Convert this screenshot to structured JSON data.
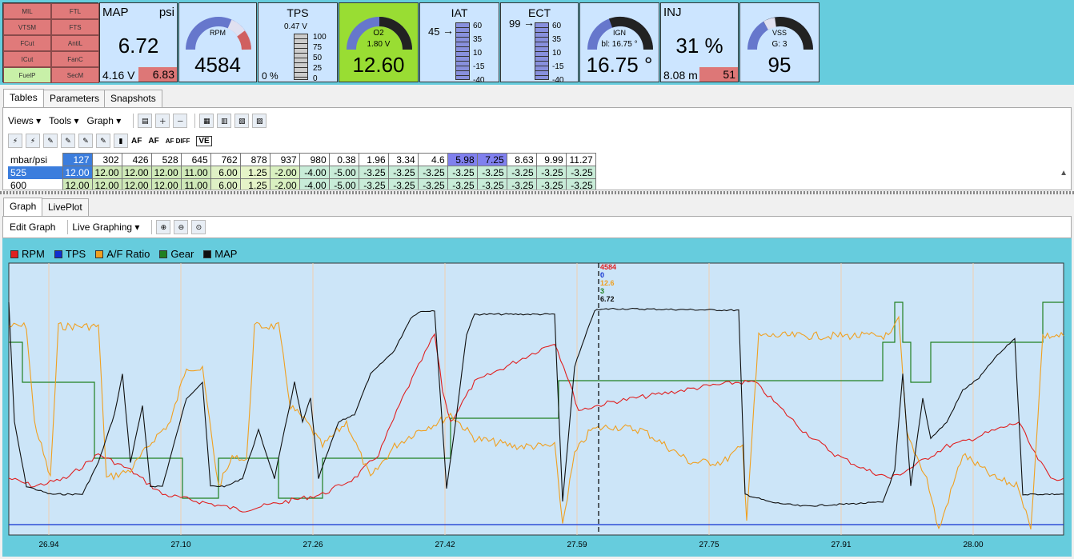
{
  "flags": [
    {
      "label": "MIL",
      "on": false
    },
    {
      "label": "FTL",
      "on": false
    },
    {
      "label": "VTSM",
      "on": false
    },
    {
      "label": "FTS",
      "on": false
    },
    {
      "label": "FCut",
      "on": false
    },
    {
      "label": "AntiL",
      "on": false
    },
    {
      "label": "ICut",
      "on": false
    },
    {
      "label": "FanC",
      "on": false
    },
    {
      "label": "FuelP",
      "on": true
    },
    {
      "label": "SecM",
      "on": false
    }
  ],
  "map": {
    "title": "MAP",
    "unit": "psi",
    "value": "6.72",
    "volts": "4.16 V",
    "alt": "6.83"
  },
  "rpm": {
    "label": "RPM",
    "value": "4584",
    "fraction": 0.55
  },
  "tps": {
    "title": "TPS",
    "volts": "0.47 V",
    "pct": "0 %",
    "scale": [
      "100",
      "75",
      "50",
      "25",
      "0"
    ]
  },
  "o2": {
    "label": "O2",
    "volts": "1.80 V",
    "value": "12.60",
    "fraction": 0.85
  },
  "iat": {
    "title": "IAT",
    "value": "45",
    "scale": [
      "60",
      "35",
      "10",
      "-15",
      "-40"
    ]
  },
  "ect": {
    "title": "ECT",
    "value": "99",
    "scale": [
      "60",
      "35",
      "10",
      "-15",
      "-40"
    ]
  },
  "ign": {
    "label": "IGN",
    "sub": "bl: 16.75 °",
    "value": "16.75 °",
    "fraction": 0.6
  },
  "inj": {
    "title": "INJ",
    "value": "31 %",
    "left": "8.08 m",
    "right": "51"
  },
  "vss": {
    "label": "VSS",
    "sub": "G: 3",
    "value": "95",
    "fraction": 0.35
  },
  "top_tabs": [
    "Tables",
    "Parameters",
    "Snapshots"
  ],
  "toolbar": {
    "views": "Views",
    "tools": "Tools",
    "graph": "Graph",
    "af1": "AF",
    "af2": "AF",
    "afdiff": "AF DIFF",
    "ve": "VE"
  },
  "fuel_table": {
    "corner": "mbar/psi",
    "columns": [
      "127",
      "302",
      "426",
      "528",
      "645",
      "762",
      "878",
      "937",
      "980",
      "0.38",
      "1.96",
      "3.34",
      "4.6",
      "5.98",
      "7.25",
      "8.63",
      "9.99",
      "11.27"
    ],
    "rows": [
      {
        "label": "525",
        "cells": [
          "12.00",
          "12.00",
          "12.00",
          "12.00",
          "11.00",
          "6.00",
          "1.25",
          "-2.00",
          "-4.00",
          "-5.00",
          "-3.25",
          "-3.25",
          "-3.25",
          "-3.25",
          "-3.25",
          "-3.25",
          "-3.25",
          "-3.25"
        ]
      },
      {
        "label": "600",
        "cells": [
          "12.00",
          "12.00",
          "12.00",
          "12.00",
          "11.00",
          "6.00",
          "1.25",
          "-2.00",
          "-4.00",
          "-5.00",
          "-3.25",
          "-3.25",
          "-3.25",
          "-3.25",
          "-3.25",
          "-3.25",
          "-3.25",
          "-3.25"
        ]
      }
    ]
  },
  "bottom_tabs": [
    "Graph",
    "LivePlot"
  ],
  "graph_toolbar": {
    "edit": "Edit Graph",
    "live": "Live Graphing"
  },
  "legend": [
    {
      "name": "RPM",
      "color": "#e02020"
    },
    {
      "name": "TPS",
      "color": "#1030d0"
    },
    {
      "name": "A/F Ratio",
      "color": "#f0a020"
    },
    {
      "name": "Gear",
      "color": "#208020"
    },
    {
      "name": "MAP",
      "color": "#101010"
    }
  ],
  "cursor": {
    "values": [
      "4584",
      "0",
      "12.6",
      "3",
      "6.72"
    ]
  },
  "x_ticks": [
    "26.94",
    "27.10",
    "27.26",
    "27.42",
    "27.59",
    "27.75",
    "27.91",
    "28.00"
  ]
}
